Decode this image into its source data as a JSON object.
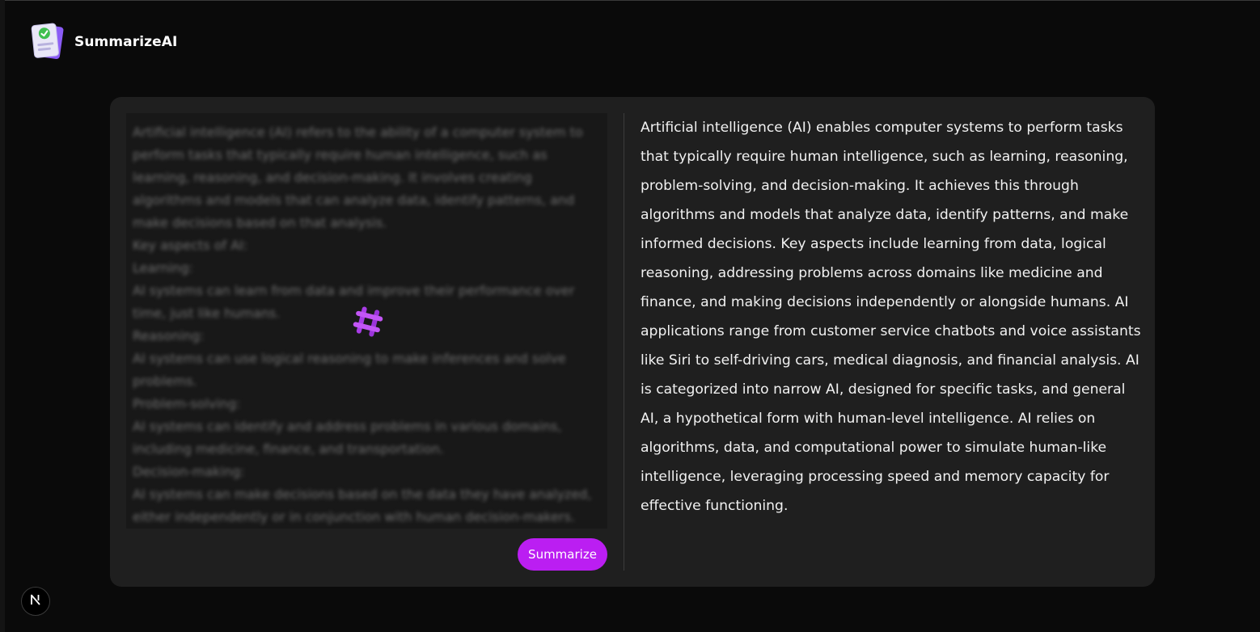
{
  "app": {
    "name": "SummarizeAI",
    "logo_icon": "document-check-icon"
  },
  "input": {
    "text": "Artificial intelligence (AI) refers to the ability of a computer system to perform tasks that typically require human intelligence, such as learning, reasoning, and decision-making. It involves creating algorithms and models that can analyze data, identify patterns, and make decisions based on that analysis.\nKey aspects of AI:\nLearning:\nAI systems can learn from data and improve their performance over time, just like humans.\nReasoning:\nAI systems can use logical reasoning to make inferences and solve problems.\nProblem-solving:\nAI systems can identify and address problems in various domains, including medicine, finance, and transportation.\nDecision-making:\nAI systems can make decisions based on the data they have analyzed, either independently or in conjunction with human decision-makers.",
    "loading_icon": "loading-spinner-icon",
    "state": "blurred-loading"
  },
  "actions": {
    "summarize_label": "Summarize"
  },
  "output": {
    "summary": "Artificial intelligence (AI) enables computer systems to perform tasks that typically require human intelligence, such as learning, reasoning, problem-solving, and decision-making. It achieves this through algorithms and models that analyze data, identify patterns, and make informed decisions. Key aspects include learning from data, logical reasoning, addressing problems across domains like medicine and finance, and making decisions independently or alongside humans. AI applications range from customer service chatbots and voice assistants like Siri to self-driving cars, medical diagnosis, and financial analysis. AI is categorized into narrow AI, designed for specific tasks, and general AI, a hypothetical form with human-level intelligence. AI relies on algorithms, data, and computational power to simulate human-like intelligence, leveraging processing speed and memory capacity for effective functioning."
  },
  "dev_badge": {
    "letter": "N",
    "icon": "nextjs-icon"
  },
  "colors": {
    "page_bg": "#0a0a0a",
    "card_bg": "#1f1f1f",
    "input_bg": "#181818",
    "accent": "#bb1ef2",
    "loader_purple": "#a83ce6",
    "text": "#f1f1f1"
  }
}
